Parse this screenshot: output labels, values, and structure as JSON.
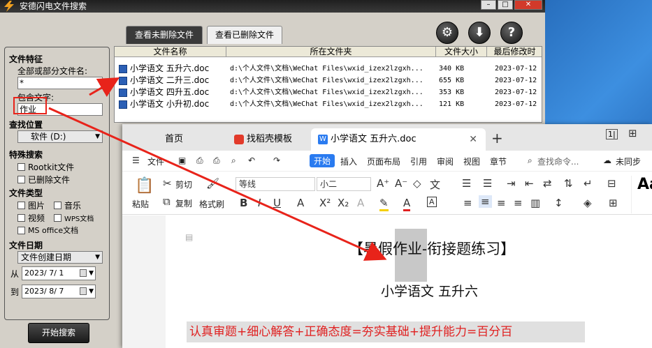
{
  "app": {
    "title": "安德闪电文件搜索",
    "tabs": {
      "active": "查看未删除文件",
      "inactive": "查看已删除文件"
    },
    "buttons": {
      "settings": "⚙",
      "download": "⬇",
      "help": "?"
    },
    "panel": {
      "features_title": "文件特征",
      "name_label": "全部或部分文件名:",
      "name_value": "*",
      "content_label": "包含文字:",
      "content_value": "作业",
      "location_title": "查找位置",
      "location_value": "软件 (D:)",
      "special_title": "特殊搜索",
      "special_opts": [
        "Rootkit文件",
        "已删除文件"
      ],
      "type_title": "文件类型",
      "type_opts": [
        "图片",
        "音乐",
        "视频",
        "WPS文档",
        "MS office文档"
      ],
      "date_title": "文件日期",
      "date_type": "文件创建日期",
      "from_label": "从",
      "from_value": "2023/ 7/ 1",
      "to_label": "到",
      "to_value": "2023/ 8/ 7"
    },
    "start_button": "开始搜索",
    "columns": [
      "文件名称",
      "所在文件夹",
      "文件大小",
      "最后修改时"
    ],
    "rows": [
      {
        "name": "小学语文 五升六.doc",
        "folder": "d:\\个人文件\\文档\\WeChat Files\\wxid_izex2lzgxh...",
        "size": "340 KB",
        "date": "2023-07-12"
      },
      {
        "name": "小学语文 二升三.doc",
        "folder": "d:\\个人文件\\文档\\WeChat Files\\wxid_izex2lzgxh...",
        "size": "655 KB",
        "date": "2023-07-12"
      },
      {
        "name": "小学语文 四升五.doc",
        "folder": "d:\\个人文件\\文档\\WeChat Files\\wxid_izex2lzgxh...",
        "size": "353 KB",
        "date": "2023-07-12"
      },
      {
        "name": "小学语文 小升初.doc",
        "folder": "d:\\个人文件\\文档\\WeChat Files\\wxid_izex2lzgxh...",
        "size": "121 KB",
        "date": "2023-07-12"
      }
    ]
  },
  "wps": {
    "tabs": {
      "home": "首页",
      "find": "找稻壳模板",
      "doc": "小学语文 五升六.doc"
    },
    "menu": {
      "file": "文件",
      "start": "开始",
      "insert": "插入",
      "layout": "页面布局",
      "ref": "引用",
      "review": "审阅",
      "view": "视图",
      "chapter": "章节",
      "search": "查找命令...",
      "sync": "未同步"
    },
    "ribbon": {
      "paste": "粘贴",
      "cut": "剪切",
      "copy": "复制",
      "format_painter": "格式刷",
      "font": "等线",
      "size": "小二",
      "style_preview": "Aa"
    },
    "doc": {
      "title": "【暑假作业-衔接题练习】",
      "subtitle": "小学语文  五升六",
      "red_line": "认真审题+细心解答+正确态度=夯实基础+提升能力=百分百"
    }
  }
}
